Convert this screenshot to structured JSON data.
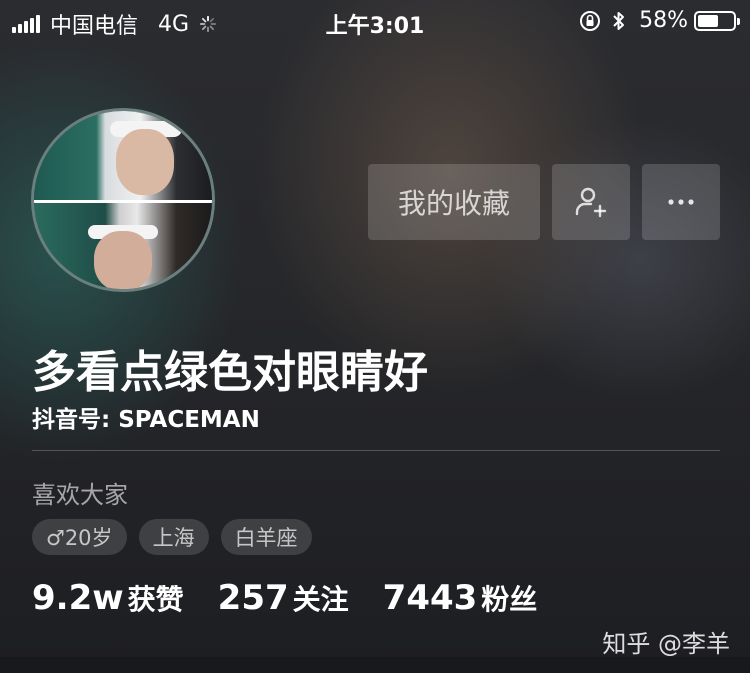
{
  "status_bar": {
    "carrier": "中国电信",
    "network": "4G",
    "time": "上午3:01",
    "battery": "58%",
    "battery_level": 0.58
  },
  "profile": {
    "nickname": "多看点绿色对眼睛好",
    "douyin_id": "抖音号: SPACEMAN",
    "bio": "喜欢大家",
    "tags": {
      "gender_age": "♂20岁",
      "city": "上海",
      "zodiac": "白羊座"
    }
  },
  "actions": {
    "favorites_label": "我的收藏",
    "add_friend_icon": "person-add-icon",
    "more_icon": "more-icon"
  },
  "stats": {
    "likes": {
      "value": "9.2w",
      "label": "获赞"
    },
    "following": {
      "value": "257",
      "label": "关注"
    },
    "followers": {
      "value": "7443",
      "label": "粉丝"
    }
  },
  "watermark": "知乎 @李羊"
}
